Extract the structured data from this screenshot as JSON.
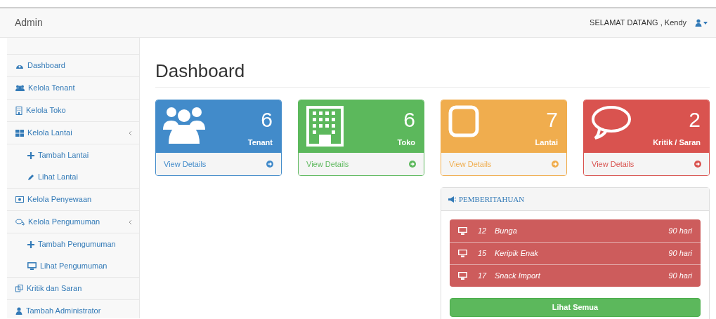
{
  "navbar": {
    "brand": "Admin",
    "greeting": "SELAMAT DATANG , Kendy"
  },
  "sidebar": {
    "items": [
      {
        "label": "Dashboard"
      },
      {
        "label": "Kelola Tenant"
      },
      {
        "label": "Kelola Toko"
      },
      {
        "label": "Kelola Lantai",
        "expanded": true,
        "children": [
          {
            "label": "Tambah Lantai"
          },
          {
            "label": "Lihat Lantai"
          }
        ]
      },
      {
        "label": "Kelola Penyewaan"
      },
      {
        "label": "Kelola Pengumuman",
        "expanded": true,
        "children": [
          {
            "label": "Tambah Pengumuman"
          },
          {
            "label": "Lihat Pengumuman"
          }
        ]
      },
      {
        "label": "Kritik dan Saran"
      },
      {
        "label": "Tambah Administrator"
      }
    ]
  },
  "page_title": "Dashboard",
  "cards": [
    {
      "count": "6",
      "label": "Tenant",
      "link": "View Details",
      "color": "#428bca"
    },
    {
      "count": "6",
      "label": "Toko",
      "link": "View Details",
      "color": "#5cb85c"
    },
    {
      "count": "7",
      "label": "Lantai",
      "link": "View Details",
      "color": "#f0ad4e"
    },
    {
      "count": "2",
      "label": "Kritik / Saran",
      "link": "View Details",
      "color": "#d9534f"
    }
  ],
  "notifications": {
    "title": "PEMBERITAHUAN",
    "items": [
      {
        "number": "12",
        "name": "Bunga",
        "duration": "90 hari"
      },
      {
        "number": "15",
        "name": "Keripik Enak",
        "duration": "90 hari"
      },
      {
        "number": "17",
        "name": "Snack Import",
        "duration": "90 hari"
      }
    ],
    "button": "Lihat Semua"
  }
}
